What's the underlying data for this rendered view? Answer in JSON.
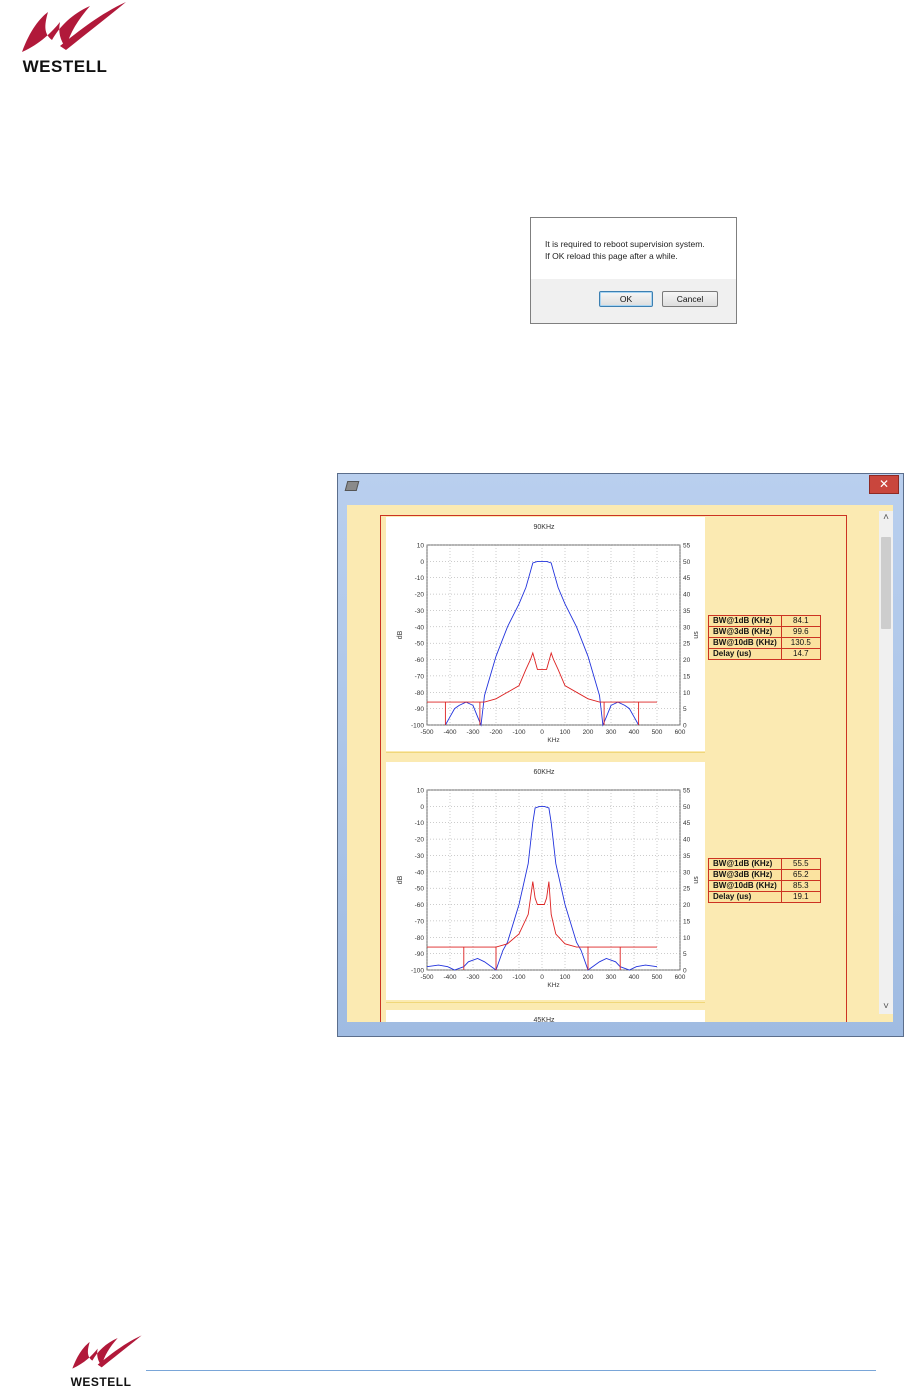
{
  "header": {
    "brand": "WESTELL"
  },
  "footer": {
    "brand": "WESTELL"
  },
  "dialog": {
    "message_line1": "It is required to reboot supervision system.",
    "message_line2": "If OK reload this page after a while.",
    "ok_label": "OK",
    "cancel_label": "Cancel"
  },
  "window": {
    "close_label": "✕",
    "scroll_up": "˄",
    "scroll_down": "˅"
  },
  "tables": [
    {
      "rows": [
        {
          "label": "BW@1dB (KHz)",
          "value": "84.1"
        },
        {
          "label": "BW@3dB (KHz)",
          "value": "99.6"
        },
        {
          "label": "BW@10dB (KHz)",
          "value": "130.5"
        },
        {
          "label": "Delay (us)",
          "value": "14.7"
        }
      ]
    },
    {
      "rows": [
        {
          "label": "BW@1dB (KHz)",
          "value": "55.5"
        },
        {
          "label": "BW@3dB (KHz)",
          "value": "65.2"
        },
        {
          "label": "BW@10dB (KHz)",
          "value": "85.3"
        },
        {
          "label": "Delay (us)",
          "value": "19.1"
        }
      ]
    }
  ],
  "chart_data": [
    {
      "type": "line",
      "title": "90KHz",
      "xlabel": "KHz",
      "ylabel": "dB",
      "y2label": "us",
      "xlim": [
        -500,
        600
      ],
      "ylim": [
        -100,
        10
      ],
      "y2lim": [
        0,
        55
      ],
      "xticks": [
        -500,
        -400,
        -300,
        -200,
        -100,
        0,
        100,
        200,
        300,
        400,
        500,
        600
      ],
      "yticks": [
        10,
        0,
        -10,
        -20,
        -30,
        -40,
        -50,
        -60,
        -70,
        -80,
        -90,
        -100
      ],
      "y2ticks": [
        55,
        50,
        45,
        40,
        35,
        30,
        25,
        20,
        15,
        10,
        5,
        0
      ],
      "grid": true,
      "series": [
        {
          "color": "#2233dd",
          "axis": "left",
          "x": [
            -420,
            -400,
            -380,
            -360,
            -330,
            -300,
            -280,
            -265,
            -250,
            -200,
            -150,
            -100,
            -70,
            -50,
            -40,
            -20,
            0,
            20,
            40,
            50,
            70,
            100,
            150,
            200,
            250,
            265,
            280,
            300,
            330,
            360,
            380,
            400,
            420
          ],
          "y": [
            -100,
            -95,
            -90,
            -88,
            -86,
            -88,
            -95,
            -100,
            -82,
            -58,
            -40,
            -26,
            -16,
            -6,
            -1,
            0,
            0,
            0,
            -1,
            -6,
            -16,
            -26,
            -40,
            -58,
            -82,
            -100,
            -95,
            -88,
            -86,
            -88,
            -90,
            -95,
            -100
          ]
        },
        {
          "color": "#dd2222",
          "axis": "right",
          "x": [
            -500,
            -420,
            -420,
            -420,
            -300,
            -270,
            -270,
            -270,
            -250,
            -200,
            -100,
            -70,
            -50,
            -40,
            -20,
            0,
            20,
            40,
            50,
            70,
            100,
            200,
            250,
            270,
            270,
            270,
            300,
            420,
            420,
            420,
            500
          ],
          "y": [
            7,
            7,
            0,
            7,
            7,
            7,
            0,
            7,
            7,
            8,
            12,
            17,
            20,
            22,
            17,
            17,
            17,
            22,
            20,
            17,
            12,
            8,
            7,
            7,
            0,
            7,
            7,
            7,
            0,
            7,
            7
          ]
        }
      ]
    },
    {
      "type": "line",
      "title": "60KHz",
      "xlabel": "KHz",
      "ylabel": "dB",
      "y2label": "us",
      "xlim": [
        -500,
        600
      ],
      "ylim": [
        -100,
        10
      ],
      "y2lim": [
        0,
        55
      ],
      "xticks": [
        -500,
        -400,
        -300,
        -200,
        -100,
        0,
        100,
        200,
        300,
        400,
        500,
        600
      ],
      "yticks": [
        10,
        0,
        -10,
        -20,
        -30,
        -40,
        -50,
        -60,
        -70,
        -80,
        -90,
        -100
      ],
      "y2ticks": [
        55,
        50,
        45,
        40,
        35,
        30,
        25,
        20,
        15,
        10,
        5,
        0
      ],
      "grid": true,
      "series": [
        {
          "color": "#2233dd",
          "axis": "left",
          "x": [
            -500,
            -450,
            -410,
            -380,
            -340,
            -320,
            -280,
            -250,
            -220,
            -200,
            -170,
            -150,
            -100,
            -60,
            -40,
            -30,
            -10,
            0,
            10,
            30,
            40,
            60,
            100,
            150,
            170,
            200,
            220,
            250,
            280,
            320,
            340,
            380,
            410,
            450,
            500
          ],
          "y": [
            -98,
            -97,
            -98,
            -100,
            -98,
            -95,
            -93,
            -95,
            -98,
            -100,
            -88,
            -83,
            -60,
            -35,
            -10,
            -1,
            0,
            0,
            0,
            -1,
            -10,
            -35,
            -60,
            -83,
            -88,
            -100,
            -98,
            -95,
            -93,
            -95,
            -98,
            -100,
            -98,
            -97,
            -98
          ]
        },
        {
          "color": "#dd2222",
          "axis": "right",
          "x": [
            -500,
            -340,
            -340,
            -340,
            -200,
            -200,
            -200,
            -150,
            -100,
            -60,
            -40,
            -30,
            -20,
            -10,
            0,
            10,
            20,
            30,
            40,
            60,
            100,
            150,
            200,
            200,
            200,
            340,
            340,
            340,
            500
          ],
          "y": [
            7,
            7,
            0,
            7,
            7,
            0,
            7,
            8,
            11,
            17,
            27,
            22,
            20,
            20,
            20,
            20,
            22,
            27,
            17,
            11,
            8,
            7,
            7,
            0,
            7,
            7,
            0,
            7,
            7
          ]
        }
      ]
    },
    {
      "type": "line",
      "title": "45KHz"
    }
  ]
}
